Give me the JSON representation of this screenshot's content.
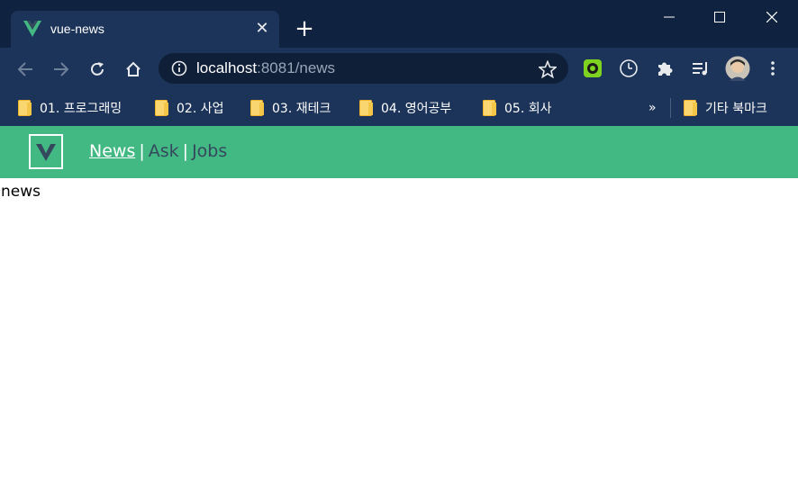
{
  "browser": {
    "tab_title": "vue-news",
    "tab_close_glyph": "✕",
    "new_tab_glyph": "+",
    "url_host": "localhost",
    "url_path": ":8081/news",
    "bookmarks": [
      {
        "label": "01. 프로그래밍"
      },
      {
        "label": "02. 사업"
      },
      {
        "label": "03. 재테크"
      },
      {
        "label": "04. 영어공부"
      },
      {
        "label": "05. 회사"
      }
    ],
    "more_bookmarks_glyph": "»",
    "other_bookmarks_label": "기타 북마크"
  },
  "app": {
    "nav": [
      {
        "label": "News",
        "active": true
      },
      {
        "label": "Ask",
        "active": false
      },
      {
        "label": "Jobs",
        "active": false
      }
    ],
    "separator": "|",
    "body_text": "news"
  },
  "colors": {
    "accent": "#42b883",
    "nav_link": "#35495e",
    "browser_frame": "#1c3459",
    "title_bar": "#0f2340"
  }
}
